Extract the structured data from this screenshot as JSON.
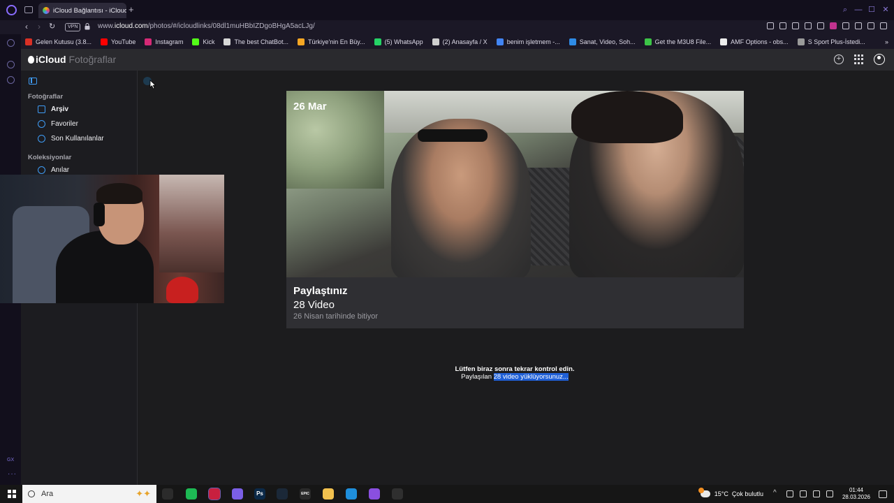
{
  "browser": {
    "tab_title": "iCloud Bağlantısı - iCloud F",
    "url_prefix": "www.",
    "url_domain": "icloud.com",
    "url_path": "/photos/#/icloudlinks/08dl1muHBbIZDgoBHgA5acLJg/",
    "vpn_label": "VPN",
    "bookmarks": [
      {
        "label": "Gelen Kutusu (3.8...",
        "icon": "gmail-icon",
        "color": "#d93025"
      },
      {
        "label": "YouTube",
        "icon": "youtube-icon",
        "color": "#ff0000"
      },
      {
        "label": "Instagram",
        "icon": "instagram-icon",
        "color": "#d62976"
      },
      {
        "label": "Kick",
        "icon": "kick-icon",
        "color": "#53fc18"
      },
      {
        "label": "The best ChatBot...",
        "icon": "chatbot-icon",
        "color": "#d8d8d8"
      },
      {
        "label": "Türkiye'nin En Büy...",
        "icon": "store-icon",
        "color": "#f5a623"
      },
      {
        "label": "(5) WhatsApp",
        "icon": "whatsapp-icon",
        "color": "#25d366"
      },
      {
        "label": "(2) Anasayfa / X",
        "icon": "x-icon",
        "color": "#cfcfcf"
      },
      {
        "label": "benim işletmem -...",
        "icon": "google-icon",
        "color": "#4285f4"
      },
      {
        "label": "Sanat, Video, Soh...",
        "icon": "globe-icon",
        "color": "#2e8be6"
      },
      {
        "label": "Get the M3U8 File...",
        "icon": "m3u8-icon",
        "color": "#3cc447"
      },
      {
        "label": "AMF Options - obs...",
        "icon": "github-icon",
        "color": "#ededed"
      },
      {
        "label": "S Sport Plus-İstedi...",
        "icon": "ssport-icon",
        "color": "#9a9a9a"
      }
    ]
  },
  "icloud": {
    "brand": "iCloud",
    "app_name": "Fotoğraflar",
    "sidebar": {
      "section1": "Fotoğraflar",
      "items1": [
        {
          "label": "Arşiv",
          "icon": "library-icon"
        },
        {
          "label": "Favoriler",
          "icon": "heart-icon"
        },
        {
          "label": "Son Kullanılanlar",
          "icon": "clock-icon"
        }
      ],
      "section2": "Koleksiyonlar",
      "items2": [
        {
          "label": "Anılar",
          "icon": "memories-icon"
        }
      ]
    },
    "card": {
      "date": "26 Mar",
      "title": "Paylaştınız",
      "count": "28 Video",
      "expiry": "26 Nisan tarihinde bitiyor"
    },
    "status": {
      "line1": "Lütfen biraz sonra tekrar kontrol edin.",
      "line2_prefix": "Paylaşılan ",
      "line2_highlight": "28 video yüklüyorsunuz..."
    }
  },
  "taskbar": {
    "search_placeholder": "Ara",
    "weather_temp": "15°C",
    "weather_desc": "Çok bulutlu",
    "time": "01:44",
    "date": "28.03.2026",
    "apps": [
      {
        "name": "task-view-icon",
        "color": "#2b2b2b",
        "glyph": ""
      },
      {
        "name": "spotify-icon",
        "color": "#1db954",
        "glyph": ""
      },
      {
        "name": "opera-gx-icon",
        "color": "#c8203f",
        "glyph": ""
      },
      {
        "name": "discord-icon",
        "color": "#7b5fe6",
        "glyph": ""
      },
      {
        "name": "photoshop-icon",
        "color": "#0b2948",
        "glyph": "Ps"
      },
      {
        "name": "steam-icon",
        "color": "#1b2838",
        "glyph": ""
      },
      {
        "name": "epic-games-icon",
        "color": "#2a2a2a",
        "glyph": "EPIC"
      },
      {
        "name": "file-explorer-icon",
        "color": "#f2c14e",
        "glyph": ""
      },
      {
        "name": "edge-icon",
        "color": "#1f8fdc",
        "glyph": ""
      },
      {
        "name": "app-circle-icon",
        "color": "#8a4fe0",
        "glyph": ""
      },
      {
        "name": "obs-icon",
        "color": "#2f2f2f",
        "glyph": ""
      }
    ]
  }
}
